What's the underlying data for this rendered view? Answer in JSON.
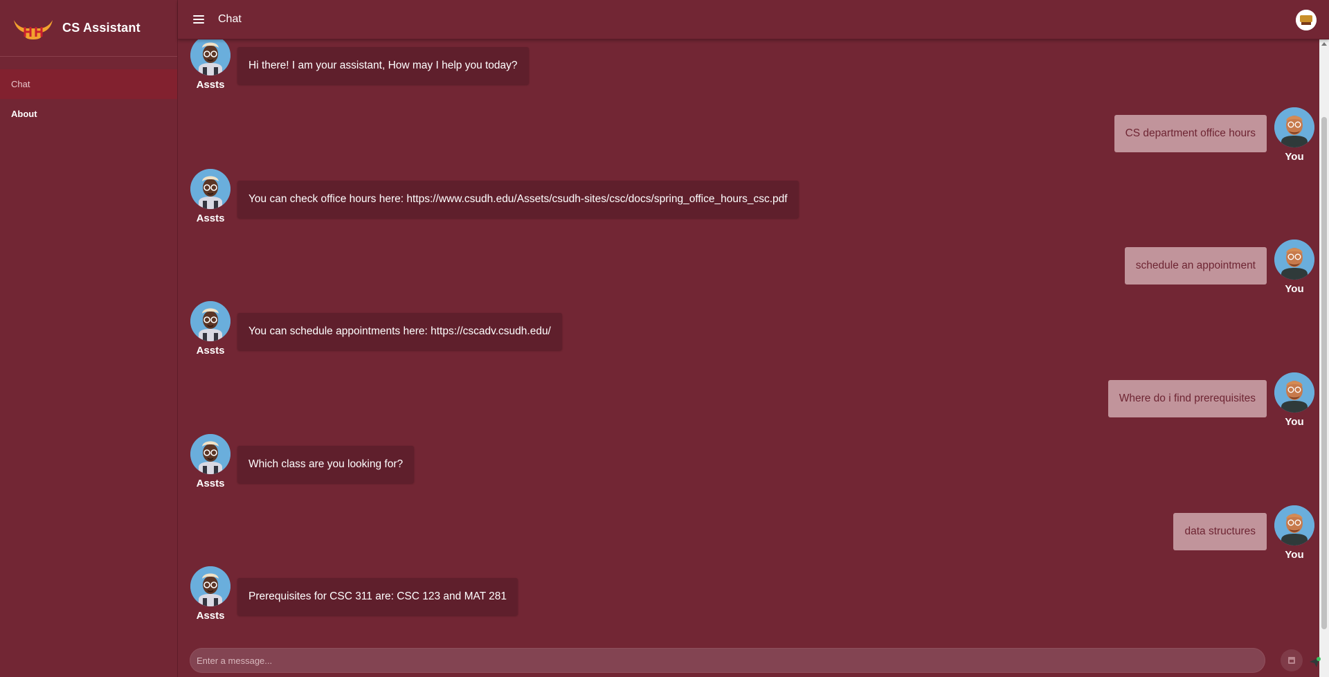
{
  "app": {
    "title": "CS Assistant"
  },
  "sidebar": {
    "items": [
      {
        "label": "Chat",
        "active": true
      },
      {
        "label": "About",
        "active": false
      }
    ]
  },
  "header": {
    "title": "Chat"
  },
  "messages": [
    {
      "sender": "Assts",
      "text": "Hi there! I am your assistant, How may I help you today?"
    },
    {
      "sender": "You",
      "text": "CS department office hours"
    },
    {
      "sender": "Assts",
      "text": "You can check office hours here: https://www.csudh.edu/Assets/csudh-sites/csc/docs/spring_office_hours_csc.pdf"
    },
    {
      "sender": "You",
      "text": "schedule an appointment"
    },
    {
      "sender": "Assts",
      "text": "You can schedule appointments here: https://cscadv.csudh.edu/"
    },
    {
      "sender": "You",
      "text": "Where do i find prerequisites"
    },
    {
      "sender": "Assts",
      "text": "Which class are you looking for?"
    },
    {
      "sender": "You",
      "text": "data structures"
    },
    {
      "sender": "Assts",
      "text": "Prerequisites for CSC 311 are: CSC 123 and MAT 281"
    }
  ],
  "composer": {
    "placeholder": "Enter a message..."
  },
  "colors": {
    "background": "#722634",
    "bot_bubble": "#5f1f2c",
    "user_bubble": "#c1949b",
    "user_text": "#6e2533",
    "active_nav": "#82212f"
  },
  "icons": {
    "menu": "hamburger-menu-icon",
    "logo": "toro-horns-logo",
    "attach": "attachment-icon",
    "send": "send-icon"
  }
}
